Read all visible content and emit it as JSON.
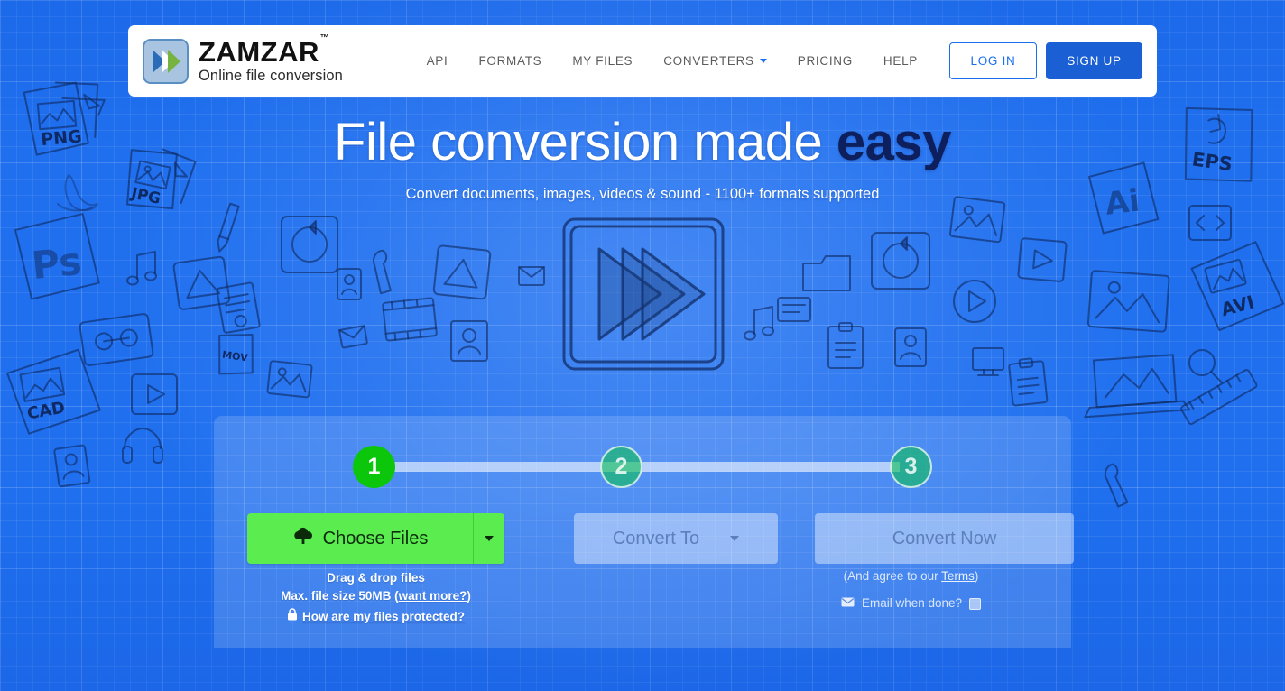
{
  "brand": {
    "icon": "zamzar-logo-icon",
    "title": "ZAMZAR",
    "tm": "™",
    "subtitle": "Online file conversion"
  },
  "nav": {
    "items": [
      {
        "label": "API",
        "has_caret": false
      },
      {
        "label": "FORMATS",
        "has_caret": false
      },
      {
        "label": "MY FILES",
        "has_caret": false
      },
      {
        "label": "CONVERTERS",
        "has_caret": true
      },
      {
        "label": "PRICING",
        "has_caret": false
      },
      {
        "label": "HELP",
        "has_caret": false
      }
    ],
    "login_label": "LOG IN",
    "signup_label": "SIGN UP"
  },
  "hero": {
    "title_plain": "File conversion made ",
    "title_emphasis": "easy",
    "subtitle": "Convert documents, images, videos & sound - 1100+ formats supported",
    "sketch_icon": "fast-forward-play-sketch-icon"
  },
  "widget": {
    "steps": [
      {
        "number": "1",
        "state": "active"
      },
      {
        "number": "2",
        "state": "pending"
      },
      {
        "number": "3",
        "state": "pending"
      }
    ],
    "choose_files_label": "Choose Files",
    "choose_files_icon": "cloud-upload-icon",
    "choose_files_caret_icon": "caret-down-icon",
    "convert_to_label": "Convert To",
    "convert_to_caret_icon": "caret-down-icon",
    "convert_now_label": "Convert Now",
    "drag_drop_label": "Drag & drop files",
    "max_size_prefix": "Max. file size 50MB (",
    "max_size_link": "want more?",
    "max_size_suffix": ")",
    "protected_icon": "lock-icon",
    "protected_label": "How are my files protected?",
    "terms_prefix": "(And agree to our ",
    "terms_link": "Terms",
    "terms_suffix": ")",
    "email_icon": "envelope-icon",
    "email_label": "Email when done?",
    "email_checked": false
  },
  "background": {
    "doodle_labels": [
      "PNG",
      "JPG",
      "Ps",
      "CAD",
      "EPS",
      "Ai",
      "AVI"
    ]
  },
  "colors": {
    "page_blue": "#1f6fee",
    "brand_blue": "#1a5fd4",
    "link_blue": "#1a6ef0",
    "step_green": "#0cc60c",
    "choose_green": "#5bec4f",
    "hero_emphasis": "#0d1f5c",
    "muted_text": "#5d7fbb"
  }
}
